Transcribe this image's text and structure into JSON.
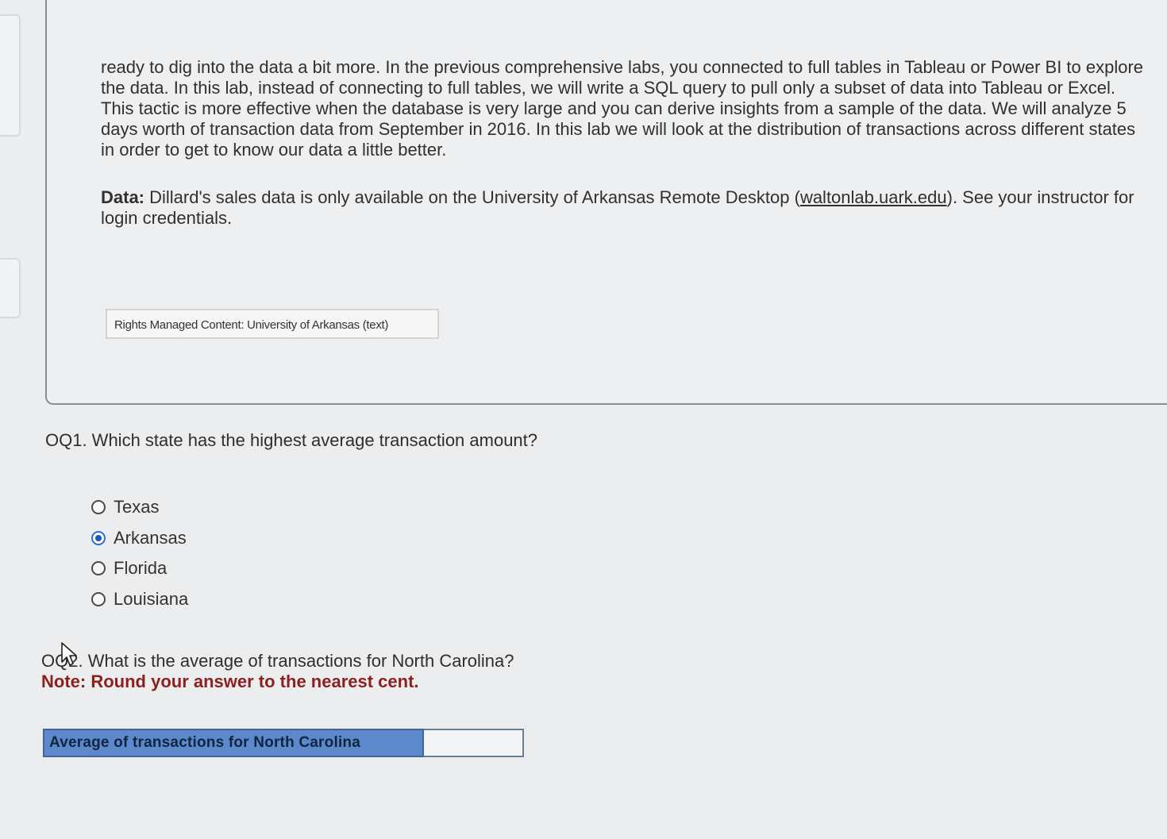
{
  "passage": {
    "paragraph_1": "ready to dig into the data a bit more. In the previous comprehensive labs, you connected to full tables in Tableau or Power BI to explore the data. In this lab, instead of connecting to full tables, we will write a SQL query to pull only a subset of data into Tableau or Excel. This tactic is more effective when the database is very large and you can derive insights from a sample of the data. We will analyze 5 days worth of transaction data from September in 2016. In this lab we will look at the distribution of transactions across different states in order to get to know our data a little better.",
    "data_label": "Data:",
    "data_text_before_link": " Dillard's sales data is only available on the University of Arkansas Remote Desktop (",
    "data_link": "waltonlab.uark.edu",
    "data_text_after_link": "). See your instructor for login credentials.",
    "rights_text": "Rights Managed Content: University of Arkansas (text)"
  },
  "oq1": {
    "question": "OQ1. Which state has the highest average transaction amount?",
    "options": [
      {
        "label": "Texas",
        "selected": false
      },
      {
        "label": "Arkansas",
        "selected": true
      },
      {
        "label": "Florida",
        "selected": false
      },
      {
        "label": "Louisiana",
        "selected": false
      }
    ]
  },
  "oq2": {
    "prefix": "OQ2",
    "question": ". What is the average of transactions for North Carolina?",
    "note": "Note: Round your answer to the nearest cent.",
    "answer_label": "Average of transactions for North Carolina",
    "answer_value": ""
  },
  "colors": {
    "note_red": "#8c1f1f",
    "label_blue": "#5b89cc",
    "radio_selected": "#1d57b8"
  }
}
